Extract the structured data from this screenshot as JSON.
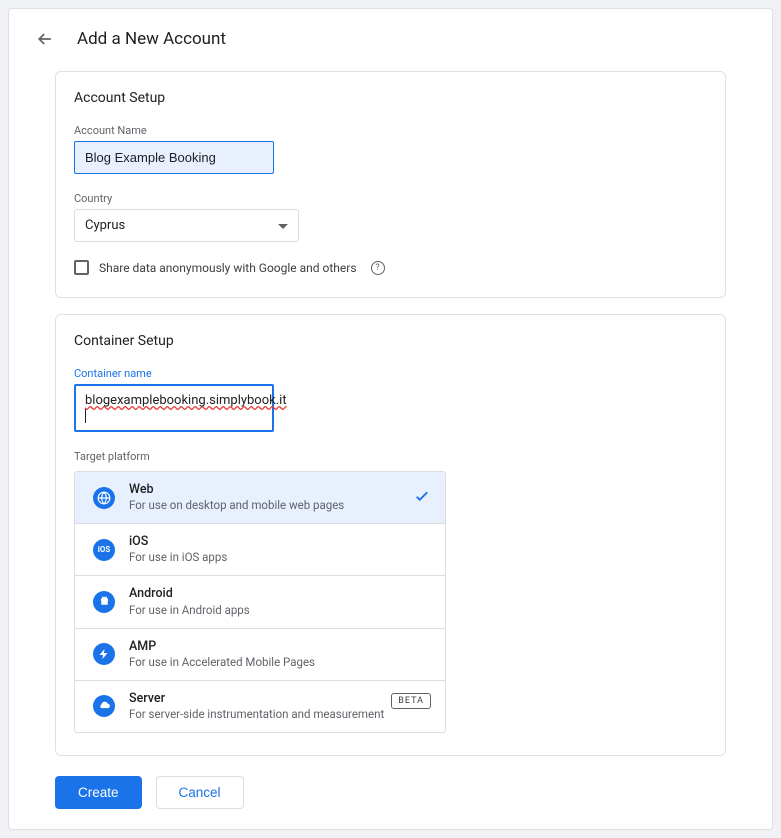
{
  "header": {
    "title": "Add a New Account"
  },
  "accountSetup": {
    "sectionTitle": "Account Setup",
    "accountNameLabel": "Account Name",
    "accountNameValue": "Blog Example Booking",
    "countryLabel": "Country",
    "countryValue": "Cyprus",
    "shareDataLabel": "Share data anonymously with Google and others"
  },
  "containerSetup": {
    "sectionTitle": "Container Setup",
    "containerNameLabel": "Container name",
    "containerNameValue": "blogexamplebooking.simplybook.it",
    "targetPlatformLabel": "Target platform",
    "platforms": [
      {
        "title": "Web",
        "desc": "For use on desktop and mobile web pages",
        "icon": "globe-icon",
        "selected": true
      },
      {
        "title": "iOS",
        "desc": "For use in iOS apps",
        "icon": "ios-icon"
      },
      {
        "title": "Android",
        "desc": "For use in Android apps",
        "icon": "android-icon"
      },
      {
        "title": "AMP",
        "desc": "For use in Accelerated Mobile Pages",
        "icon": "bolt-icon"
      },
      {
        "title": "Server",
        "desc": "For server-side instrumentation and measurement",
        "icon": "cloud-icon",
        "badge": "BETA"
      }
    ]
  },
  "footer": {
    "create": "Create",
    "cancel": "Cancel"
  }
}
